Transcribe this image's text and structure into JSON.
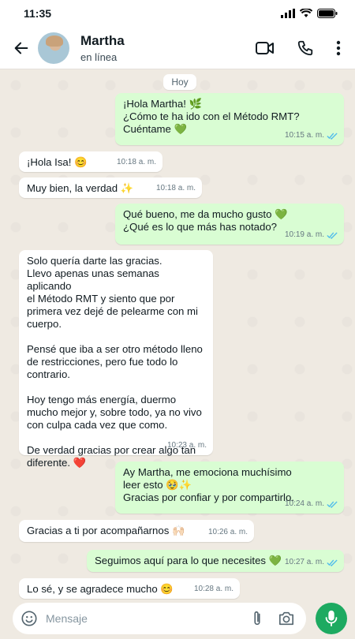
{
  "statusbar": {
    "time": "11:35"
  },
  "header": {
    "name": "Martha",
    "status": "en línea"
  },
  "day_label": "Hoy",
  "messages": [
    {
      "dir": "out",
      "text": "¡Hola Martha! 🌿\n¿Cómo te ha ido con el Método RMT?\nCuéntame 💚",
      "time": "10:15 a. m.",
      "read": true
    },
    {
      "dir": "in",
      "text": "¡Hola Isa! 😊",
      "time": "10:18 a. m."
    },
    {
      "dir": "in",
      "text": "Muy bien, la verdad ✨",
      "time": "10:18 a. m."
    },
    {
      "dir": "out",
      "text": "Qué bueno, me da mucho gusto 💚\n¿Qué es lo que más has notado?",
      "time": "10:19 a. m.",
      "read": true
    },
    {
      "dir": "in",
      "text": "Solo quería darte las gracias.\nLlevo apenas unas semanas aplicando\nel Método RMT y siento que por\nprimera vez dejé de pelearme con mi\ncuerpo.\n\nPensé que iba a ser otro método lleno\nde restricciones, pero fue todo lo\ncontrario.\n\nHoy tengo más energía, duermo\nmucho mejor y, sobre todo, ya no vivo\ncon culpa cada vez que como.\n\nDe verdad gracias por crear algo tan\ndiferente. ❤️",
      "time": "10:23 a. m."
    },
    {
      "dir": "out",
      "text": "Ay Martha, me emociona muchísimo\nleer esto 🥹✨\nGracias por confiar y por compartirlo.",
      "time": "10:24 a. m.",
      "read": true
    },
    {
      "dir": "in",
      "text": "Gracias a ti por acompañarnos 🙌🏻",
      "time": "10:26 a. m."
    },
    {
      "dir": "out",
      "text": "Seguimos aquí para lo que necesites 💚",
      "time": "10:27 a. m.",
      "read": true
    },
    {
      "dir": "in",
      "text": "Lo sé, y se agradece mucho 😊",
      "time": "10:28 a. m."
    }
  ],
  "composer": {
    "placeholder": "Mensaje"
  },
  "icons": {
    "back": "arrow-left-icon",
    "video": "video-call-icon",
    "call": "phone-icon",
    "menu": "more-vertical-icon",
    "emoji": "emoji-icon",
    "attach": "paperclip-icon",
    "camera": "camera-icon",
    "mic": "microphone-icon",
    "read": "double-check-icon"
  },
  "colors": {
    "incoming_bubble": "#ffffff",
    "outgoing_bubble": "#d9fdd3",
    "read_ticks": "#53bdeb",
    "mic_button": "#1daa61"
  }
}
